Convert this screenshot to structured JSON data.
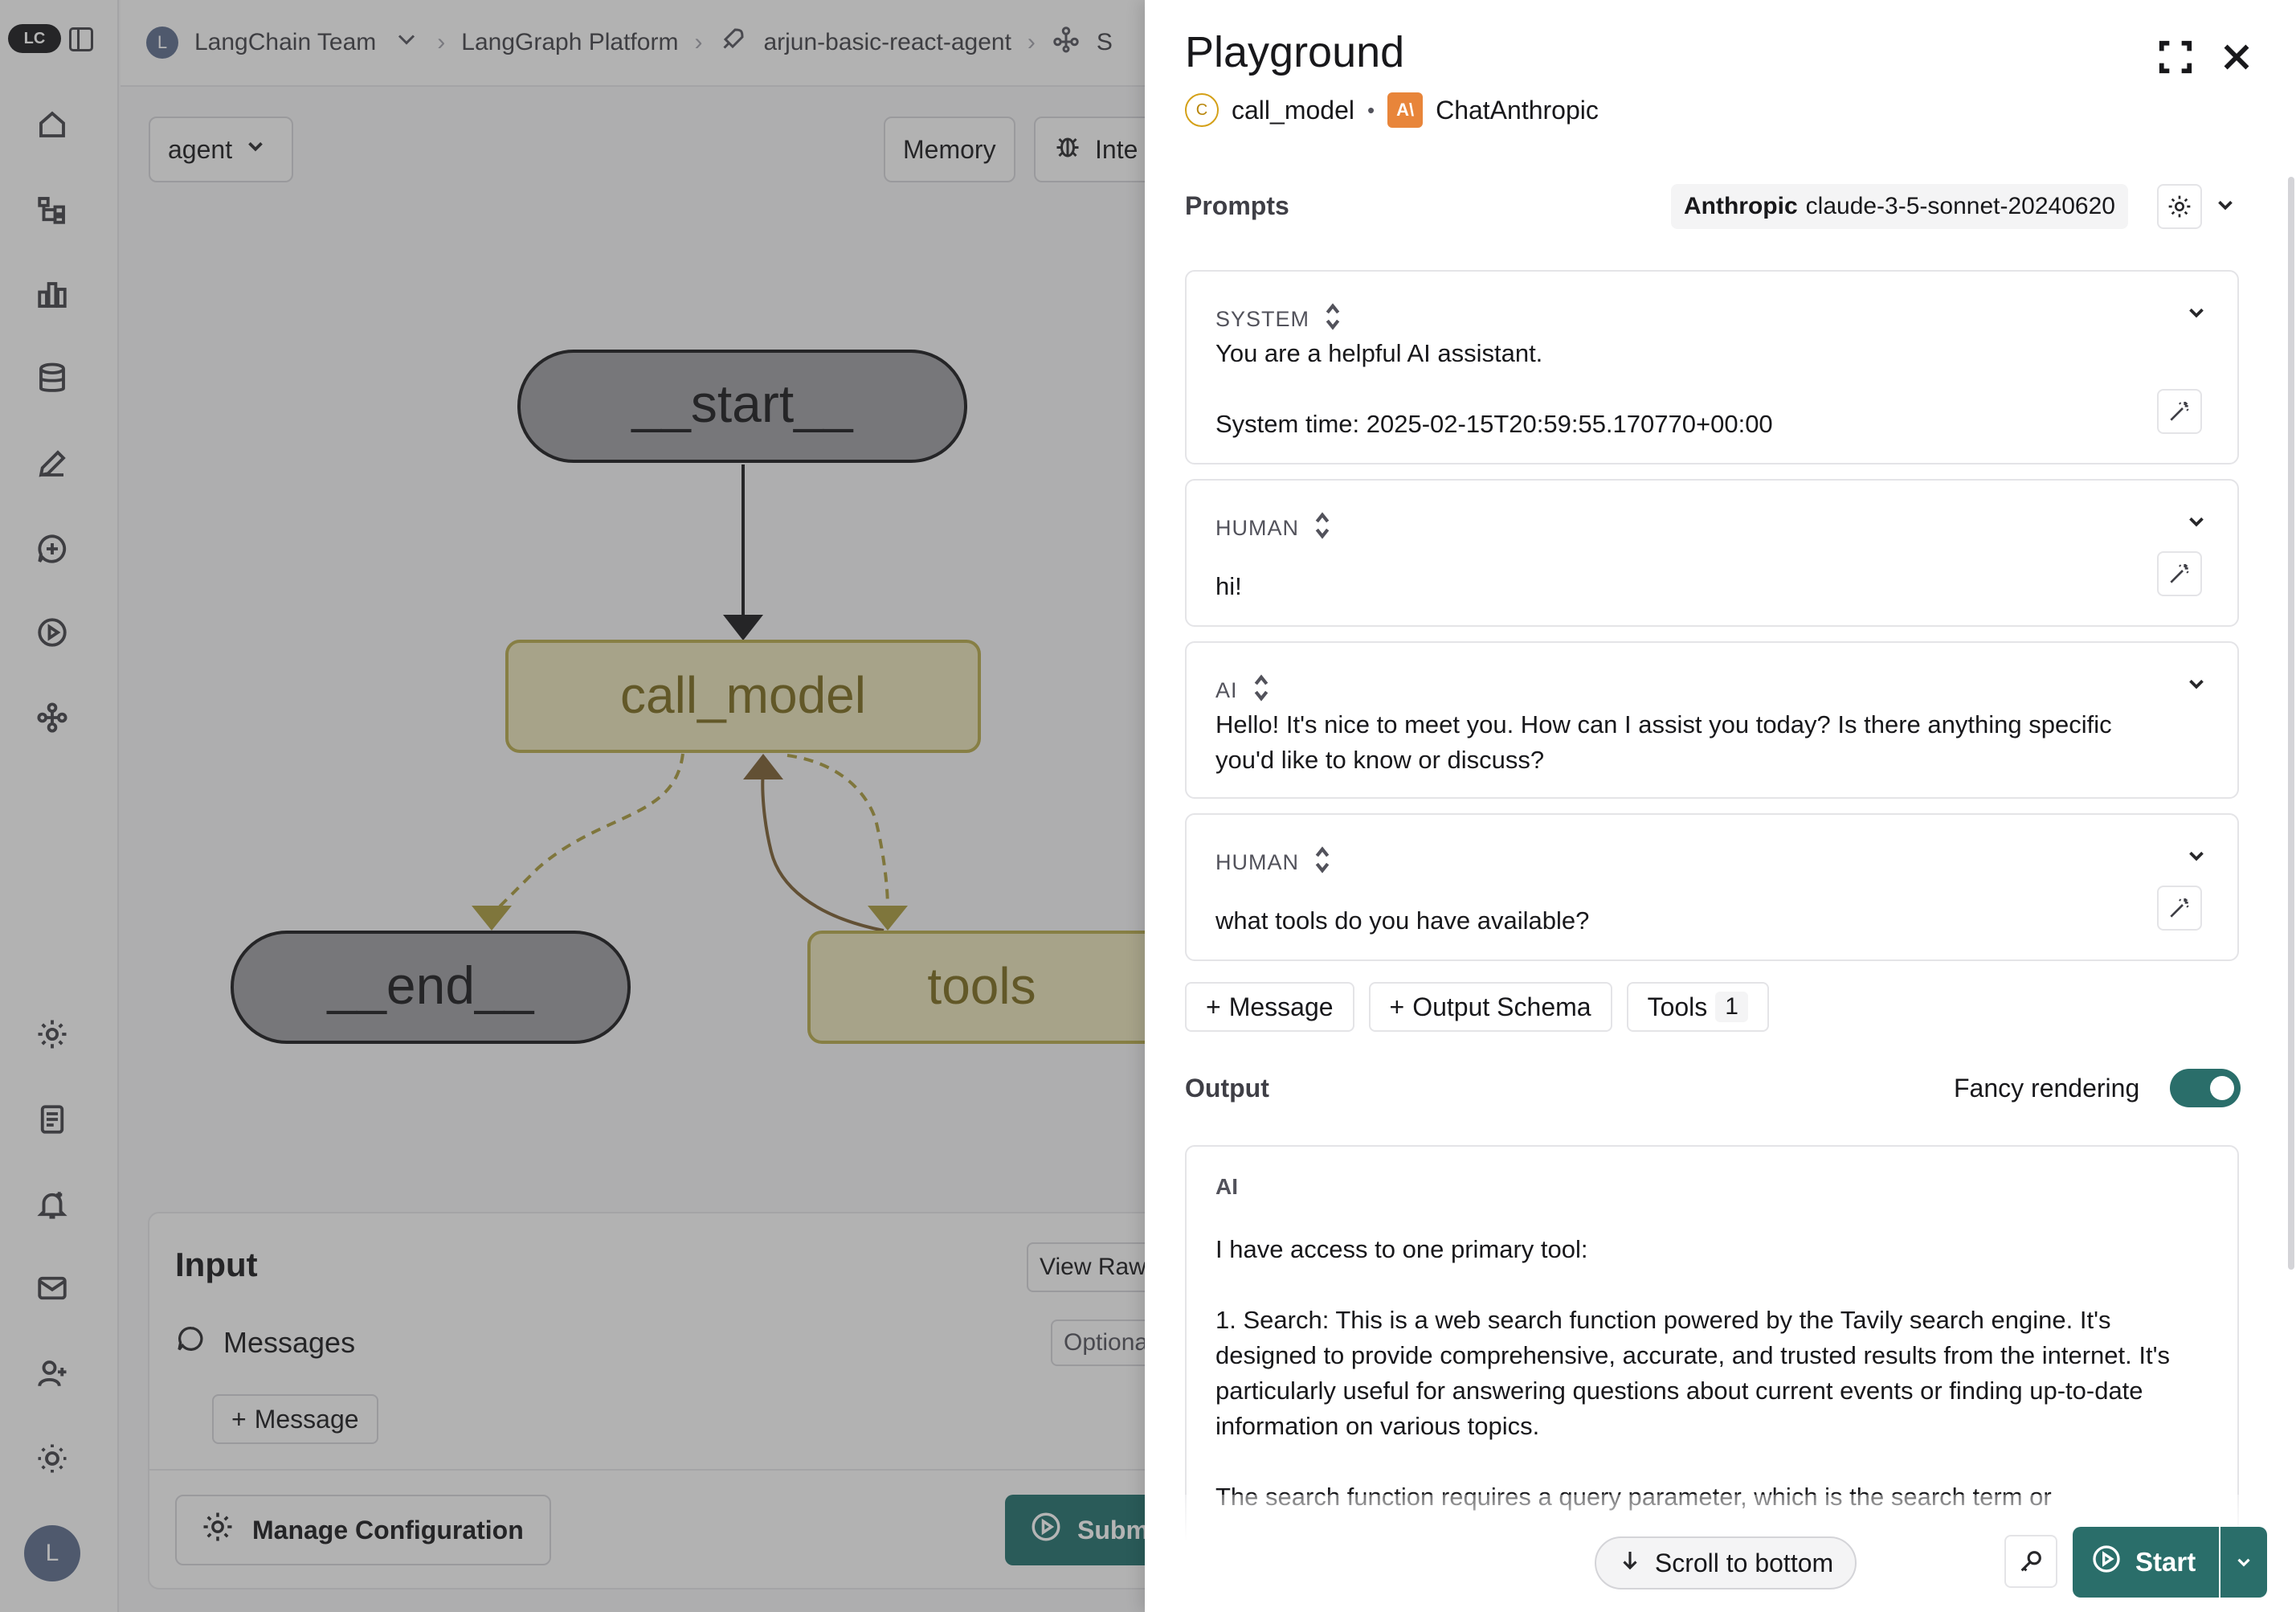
{
  "breadcrumb": {
    "org_initial": "L",
    "org": "LangChain Team",
    "platform": "LangGraph Platform",
    "deployment": "arjun-basic-react-agent",
    "studio_cut": "S"
  },
  "toolbar": {
    "graph_select": "agent",
    "memory_label": "Memory",
    "interrupt_cut": "Inte"
  },
  "graph": {
    "nodes": [
      {
        "id": "start",
        "label": "__start__"
      },
      {
        "id": "call_model",
        "label": "call_model"
      },
      {
        "id": "end",
        "label": "__end__"
      },
      {
        "id": "tools",
        "label": "tools"
      }
    ],
    "colors": {
      "terminal": "#9c9ca0",
      "active_fill": "#e9e2b8",
      "active_border": "#b5a84a",
      "active_text": "#7a6a1c",
      "edge_dashed": "#a89a3c",
      "edge_solid": "#7a5c30"
    }
  },
  "input_panel": {
    "title": "Input",
    "view_raw_cut": "View Raw",
    "messages_label": "Messages",
    "optional_cut": "Optiona",
    "add_message_label": "Message",
    "manage_config_label": "Manage Configuration",
    "submit_label": "Submit"
  },
  "rail": {
    "logo_text": "LC",
    "avatar_initial": "L",
    "icons": [
      "home-icon",
      "graph-icon",
      "chart-icon",
      "database-icon",
      "pen-icon",
      "chat-plus-icon",
      "play-circle-icon",
      "nodes-icon",
      "settings-icon",
      "docs-icon",
      "bell-plus-icon",
      "mail-icon",
      "user-plus-icon",
      "sun-icon"
    ]
  },
  "playground": {
    "title": "Playground",
    "node_badge": "C",
    "node_name": "call_model",
    "bullet": "•",
    "provider_badge": "A\\",
    "provider_name": "ChatAnthropic",
    "prompts_label": "Prompts",
    "model_provider": "Anthropic",
    "model_name": "claude-3-5-sonnet-20240620",
    "messages": [
      {
        "role": "SYSTEM",
        "text": "You are a helpful AI assistant.\n\nSystem time: 2025-02-15T20:59:55.170770+00:00"
      },
      {
        "role": "HUMAN",
        "text": "hi!"
      },
      {
        "role": "AI",
        "text": "Hello! It's nice to meet you. How can I assist you today? Is there anything specific\nyou'd like to know or discuss?"
      },
      {
        "role": "HUMAN",
        "text": "what tools do you have available?"
      }
    ],
    "add_message_label": "Message",
    "output_schema_label": "Output Schema",
    "tools_label": "Tools",
    "tools_count": "1",
    "output_label": "Output",
    "fancy_rendering_label": "Fancy rendering",
    "fancy_rendering_on": true,
    "output_role": "AI",
    "output_text": "I have access to one primary tool:\n\n1. Search: This is a web search function powered by the Tavily search engine. It's designed to provide comprehensive, accurate, and trusted results from the internet. It's particularly useful for answering questions about current events or finding up-to-date information on various topics.\n\nThe search function requires a query parameter, which is the search term or",
    "scroll_bottom_label": "Scroll to bottom",
    "start_label": "Start",
    "accent_color": "#2a6e6a"
  }
}
